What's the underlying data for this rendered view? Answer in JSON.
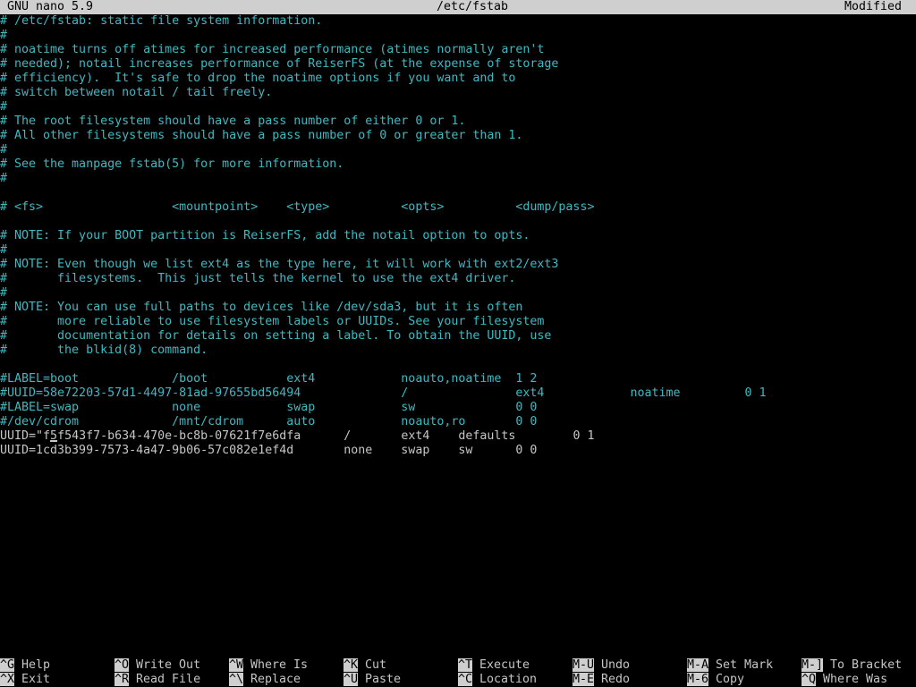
{
  "titlebar": {
    "app": "GNU nano 5.9",
    "file": "/etc/fstab",
    "status": "Modified"
  },
  "lines": [
    "# /etc/fstab: static file system information.",
    "#",
    "# noatime turns off atimes for increased performance (atimes normally aren't",
    "# needed); notail increases performance of ReiserFS (at the expense of storage",
    "# efficiency).  It's safe to drop the noatime options if you want and to",
    "# switch between notail / tail freely.",
    "#",
    "# The root filesystem should have a pass number of either 0 or 1.",
    "# All other filesystems should have a pass number of 0 or greater than 1.",
    "#",
    "# See the manpage fstab(5) for more information.",
    "#",
    "",
    "# <fs>                  <mountpoint>    <type>          <opts>          <dump/pass>",
    "",
    "# NOTE: If your BOOT partition is ReiserFS, add the notail option to opts.",
    "#",
    "# NOTE: Even though we list ext4 as the type here, it will work with ext2/ext3",
    "#       filesystems.  This just tells the kernel to use the ext4 driver.",
    "#",
    "# NOTE: You can use full paths to devices like /dev/sda3, but it is often",
    "#       more reliable to use filesystem labels or UUIDs. See your filesystem",
    "#       documentation for details on setting a label. To obtain the UUID, use",
    "#       the blkid(8) command.",
    "",
    "#LABEL=boot             /boot           ext4            noauto,noatime  1 2",
    "#UUID=58e72203-57d1-4497-81ad-97655bd56494              /               ext4            noatime         0 1",
    "#LABEL=swap             none            swap            sw              0 0",
    "#/dev/cdrom             /mnt/cdrom      auto            noauto,ro       0 0",
    "UUID=\"f5f543f7-b634-470e-bc8b-07621f7e6dfa      /       ext4    defaults        0 1",
    "UUID=1cd3b399-7573-4a47-9b06-57c082e1ef4d       none    swap    sw      0 0"
  ],
  "shortcuts": [
    {
      "key": "^G",
      "label": "Help"
    },
    {
      "key": "^X",
      "label": "Exit"
    },
    {
      "key": "^O",
      "label": "Write Out"
    },
    {
      "key": "^R",
      "label": "Read File"
    },
    {
      "key": "^W",
      "label": "Where Is"
    },
    {
      "key": "^\\",
      "label": "Replace"
    },
    {
      "key": "^K",
      "label": "Cut"
    },
    {
      "key": "^U",
      "label": "Paste"
    },
    {
      "key": "^T",
      "label": "Execute"
    },
    {
      "key": "^C",
      "label": "Location"
    },
    {
      "key": "M-U",
      "label": "Undo"
    },
    {
      "key": "M-E",
      "label": "Redo"
    },
    {
      "key": "M-A",
      "label": "Set Mark"
    },
    {
      "key": "M-6",
      "label": "Copy"
    },
    {
      "key": "M-]",
      "label": "To Bracket"
    },
    {
      "key": "^Q",
      "label": "Where Was"
    }
  ]
}
